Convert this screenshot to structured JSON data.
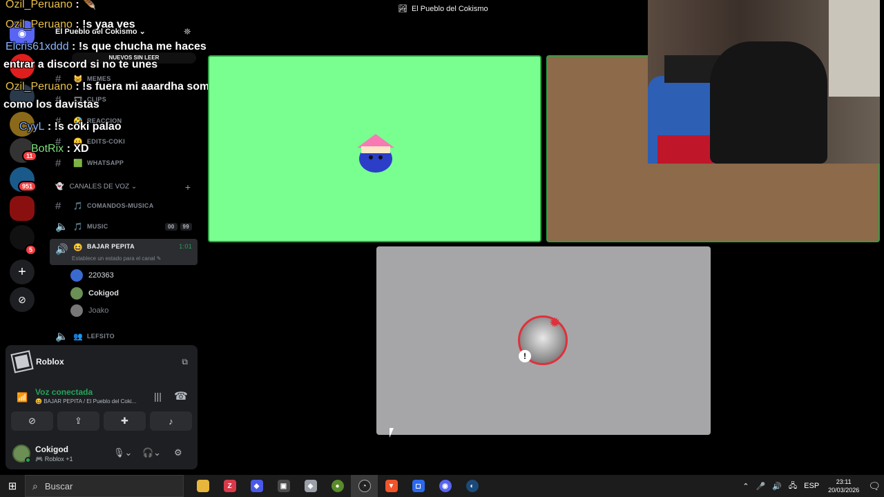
{
  "server": {
    "name": "El Pueblo del Cokismo",
    "unread_pill": "NUEVOS SIN LEER",
    "rail_badges": [
      "11",
      "951",
      "5"
    ]
  },
  "channels": {
    "text": [
      {
        "emoji": "😸",
        "name": "MEMES"
      },
      {
        "emoji": "🎞",
        "name": "CLIPS"
      },
      {
        "emoji": "🤣",
        "name": "REACCION"
      },
      {
        "emoji": "😛",
        "name": "EDITS-COKI"
      },
      {
        "emoji": "🟩",
        "name": "WHATSAPP"
      }
    ],
    "voice_category": "CANALES DE VOZ",
    "voice": [
      {
        "emoji": "🎵",
        "name": "COMANDOS-MUSICA",
        "kind": "text"
      },
      {
        "emoji": "🎵",
        "name": "MUSIC",
        "pill_a": "00",
        "pill_b": "99"
      },
      {
        "emoji": "😆",
        "name": "BAJAR PEPITA",
        "timer": "1:01"
      }
    ],
    "status_hint": "Establece un estado para el canal",
    "members": [
      "220363",
      "Cokigod",
      "Joako"
    ],
    "last_channel": {
      "emoji": "👥",
      "name": "LEFSITO"
    }
  },
  "chat": [
    {
      "user": "Ozil_Peruano",
      "msg": " : ",
      "color": "#e8c04a"
    },
    {
      "user": "Ozil_Peruano",
      "msg": " : !s yaa ves",
      "color": "#e8c04a"
    },
    {
      "user": "Elcris61xddd",
      "msg": " : !s que chucha me haces",
      "color": "#8ab4ff"
    },
    {
      "user": "",
      "msg": "entrar a discord si no te unes",
      "color": "#fff"
    },
    {
      "user": "Ozil_Peruano",
      "msg": " : !s fuera mi aaardha somos",
      "color": "#e8c04a"
    },
    {
      "user": "",
      "msg": "como los davistas",
      "color": "#fff"
    },
    {
      "user": "CyyL",
      "msg": " : !s coki palao",
      "color": "#8ab4ff"
    },
    {
      "user": "BotRix",
      "msg": " : XD",
      "color": "#7ee07e"
    }
  ],
  "activity": {
    "name": "Roblox"
  },
  "voice_status": {
    "title": "Voz conectada",
    "subtitle": "BAJAR PEPITA / El Pueblo del Coki..."
  },
  "user": {
    "name": "Cokigod",
    "status": "Roblox +1"
  },
  "stage": {
    "title": "El Pueblo del Cokismo"
  },
  "taskbar": {
    "search_placeholder": "Buscar",
    "lang": "ESP",
    "time": "23:11",
    "date": "20/03/2026"
  },
  "colors": {
    "green_tile": "#79ff90",
    "brown_tile": "#8c6a4a",
    "grey_tile": "#a6a6a8",
    "voice_green": "#23a55a"
  }
}
